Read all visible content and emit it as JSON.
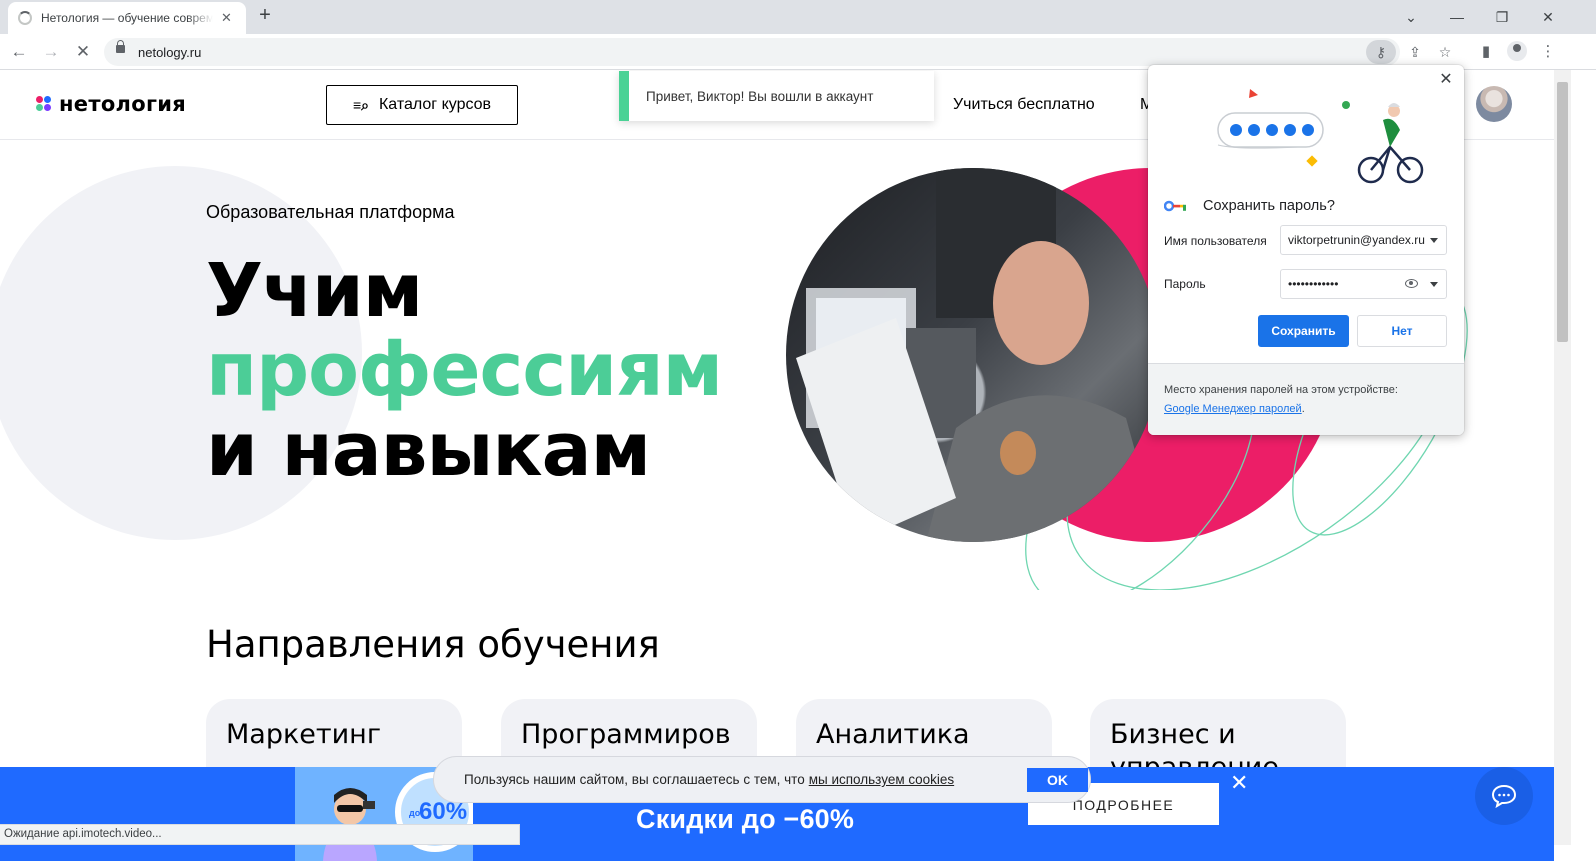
{
  "browser": {
    "tab_title": "Нетология — обучение современным профессиям",
    "url": "netology.ru",
    "status_text": "Ожидание api.imotech.video..."
  },
  "site": {
    "logo_text": "нетология",
    "catalog_label": "Каталог курсов",
    "nav_learn_free": "Учиться бесплатно",
    "nav_partial": "М",
    "toast_text": "Привет, Виктор! Вы вошли в аккаунт"
  },
  "hero": {
    "subtitle": "Образовательная платформа",
    "line1": "Учим",
    "line2": "профессиям",
    "line3": "и навыкам"
  },
  "directions": {
    "title": "Направления обучения",
    "cards": [
      {
        "label": "Маркетинг"
      },
      {
        "label": "Программиров"
      },
      {
        "label": "Аналитика"
      },
      {
        "label": "Бизнес и управление"
      }
    ]
  },
  "promo": {
    "badge_prefix": "до",
    "badge_value": "60%",
    "headline": "Скидки до −60%",
    "more_label": "ПОДРОБНЕЕ"
  },
  "cookie": {
    "text": "Пользуясь нашим сайтом, вы соглашаетесь с тем, что",
    "link": "мы используем cookies",
    "ok_label": "OK"
  },
  "password_bubble": {
    "title": "Сохранить пароль?",
    "username_label": "Имя пользователя",
    "username_value": "viktorpetrunin@yandex.ru",
    "password_label": "Пароль",
    "password_value": "••••••••••••",
    "save_label": "Сохранить",
    "no_label": "Нет",
    "footer_text": "Место хранения паролей на этом устройстве:",
    "footer_link": "Google Менеджер паролей",
    "footer_suffix": "."
  },
  "colors": {
    "accent_green": "#4ccd97",
    "accent_pink": "#ec1e67",
    "promo_blue": "#1f6aff",
    "chrome_blue": "#1a73e8"
  }
}
